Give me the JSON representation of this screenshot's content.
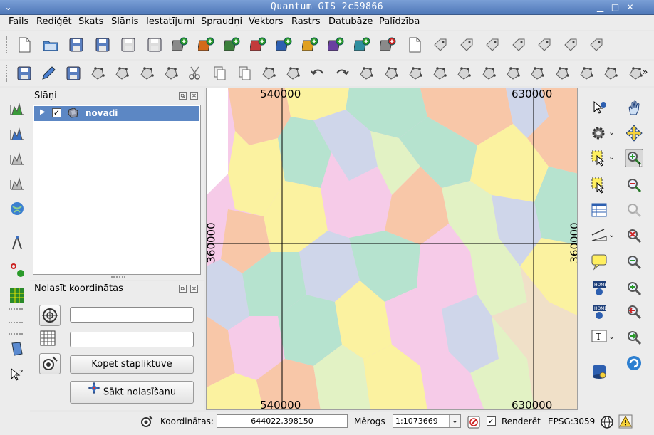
{
  "window": {
    "title": "Quantum GIS 2c59866"
  },
  "menu": [
    "Fails",
    "Rediģēt",
    "Skats",
    "Slānis",
    "Iestatījumi",
    "Spraudņi",
    "Vektors",
    "Rastrs",
    "Datubāze",
    "Palīdzība"
  ],
  "toolbar1_icons": [
    "new-project-icon",
    "open-project-icon",
    "save-project-icon",
    "save-as-icon",
    "new-print-composer-icon",
    "print-icon",
    "add-vector-layer-icon",
    "add-raster-layer-icon",
    "add-postgis-layer-icon",
    "add-spatialite-layer-icon",
    "add-mssql-layer-icon",
    "add-wms-layer-icon",
    "add-wcs-layer-icon",
    "add-wfs-layer-icon",
    "remove-layer-icon",
    "new-shapefile-icon",
    "spell-check-icon",
    "label-icon",
    "label-pin-icon",
    "label-show-icon",
    "label-move-icon",
    "label-rotate-icon",
    "label-change-icon"
  ],
  "toolbar2_icons": [
    "edit-save-icon",
    "pencil-icon",
    "save-edits-icon",
    "add-feature-icon",
    "move-feature-icon",
    "node-tool-icon",
    "delete-selected-icon",
    "cut-features-icon",
    "copy-features-icon",
    "paste-features-icon",
    "vertex-a-icon",
    "vertex-b-icon",
    "undo-icon",
    "redo-icon",
    "simplify-icon",
    "add-ring-icon",
    "add-part-icon",
    "fill-ring-icon",
    "delete-ring-icon",
    "delete-part-icon",
    "reshape-icon",
    "offset-curve-icon",
    "split-features-icon",
    "merge-features-icon",
    "merge-attributes-icon",
    "rotate-point-icon"
  ],
  "layers_panel": {
    "title": "Slāņi",
    "layers": [
      {
        "name": "novadi",
        "checked": true
      }
    ]
  },
  "coords_panel": {
    "title": "Nolasīt koordinātas",
    "copy_button": "Kopēt stapliktuvē",
    "start_button": "Sākt nolasīšanu",
    "field1_value": "",
    "field2_value": ""
  },
  "map": {
    "grid_x_top": [
      "540000",
      "630000"
    ],
    "grid_x_bottom": [
      "540000",
      "630000"
    ],
    "grid_y_left": "360000",
    "grid_y_right": "360000",
    "colors": [
      "#f8c7a8",
      "#f6cbe8",
      "#cfd6ea",
      "#b6e3cf",
      "#fbf2a0",
      "#e2f2c4",
      "#f0e0c8"
    ]
  },
  "status": {
    "coord_label": "Koordinātas:",
    "coord_value": "644022,398150",
    "scale_label": "Mērogs",
    "scale_value": "1:1073669",
    "render_label": "Renderēt",
    "render_checked": true,
    "crs": "EPSG:3059"
  }
}
